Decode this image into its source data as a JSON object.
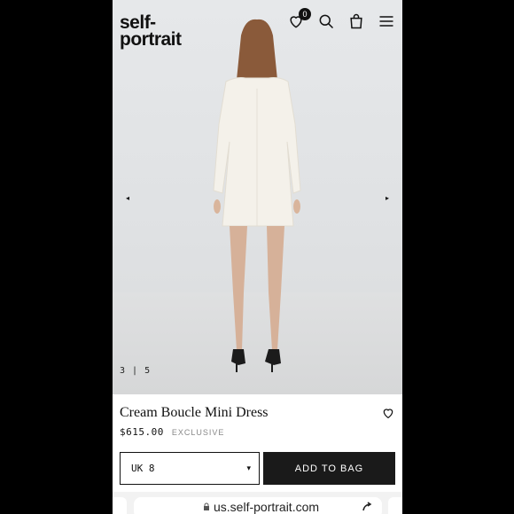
{
  "brand": {
    "logo_text": "self-\nportrait"
  },
  "header": {
    "cart_count": "0"
  },
  "gallery": {
    "counter": "3 | 5",
    "prev": "◂",
    "next": "▸"
  },
  "product": {
    "name": "Cream Boucle Mini Dress",
    "price": "$615.00",
    "tag": "EXCLUSIVE",
    "size_selected": "UK 8",
    "caret": "▾",
    "add_to_bag_label": "ADD TO BAG"
  },
  "browser": {
    "url": "us.self-portrait.com"
  },
  "colors": {
    "accent": "#1a1a1a",
    "background": "#ffffff",
    "tag": "#888888"
  }
}
